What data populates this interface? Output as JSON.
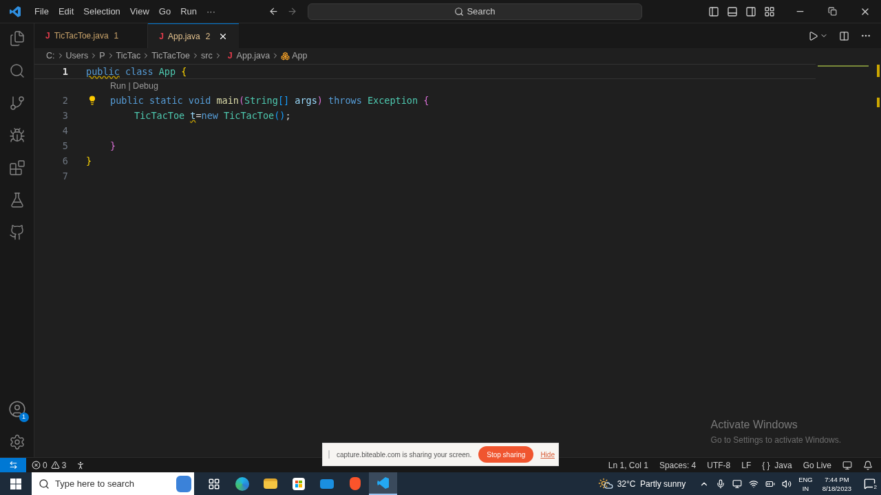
{
  "menu": [
    "File",
    "Edit",
    "Selection",
    "View",
    "Go",
    "Run",
    "···"
  ],
  "search": {
    "placeholder": "Search"
  },
  "tabs": [
    {
      "icon": "J",
      "label": "TicTacToe.java",
      "count": "1",
      "selected": false
    },
    {
      "icon": "J",
      "label": "App.java",
      "count": "2",
      "selected": true
    }
  ],
  "breadcrumb": [
    {
      "text": "C:",
      "kind": "folder"
    },
    {
      "text": "Users",
      "kind": "folder"
    },
    {
      "text": "P",
      "kind": "folder"
    },
    {
      "text": "TicTac",
      "kind": "folder"
    },
    {
      "text": "TicTacToe",
      "kind": "folder"
    },
    {
      "text": "src",
      "kind": "folder"
    },
    {
      "text": "App.java",
      "kind": "java",
      "icon": "J"
    },
    {
      "text": "App",
      "kind": "class"
    }
  ],
  "code": [
    {
      "number": "1",
      "current": true,
      "tokens": [
        {
          "text": "public",
          "kind": "keyword",
          "warning": true
        },
        {
          "text": " class",
          "kind": "keyword"
        },
        {
          "text": " App",
          "kind": "type"
        },
        {
          "text": " {",
          "kind": "bracket1"
        }
      ],
      "children": [
        {
          "number": "2",
          "codelens": "Run | Debug",
          "lightbulb": true,
          "tokens": [
            {
              "text": "public",
              "kind": "keyword"
            },
            {
              "text": " static",
              "kind": "keyword"
            },
            {
              "text": " void",
              "kind": "keyword"
            },
            {
              "text": " main",
              "kind": "function"
            },
            {
              "text": "(",
              "kind": "bracket2"
            },
            {
              "text": "String",
              "kind": "type"
            },
            {
              "text": "[]",
              "kind": "bracket3"
            },
            {
              "text": " args",
              "kind": "variable"
            },
            {
              "text": ")",
              "kind": "bracket2"
            },
            {
              "text": " throws",
              "kind": "keyword"
            },
            {
              "text": " Exception",
              "kind": "type"
            },
            {
              "text": " {",
              "kind": "bracket2"
            }
          ],
          "children": [
            {
              "number": "3",
              "tokens": [
                {
                  "text": "TicTacToe ",
                  "kind": "type"
                },
                {
                  "text": "t",
                  "kind": "variable",
                  "warning": true
                },
                {
                  "text": "=",
                  "kind": "plain"
                },
                {
                  "text": "new",
                  "kind": "keyword"
                },
                {
                  "text": " TicTacToe",
                  "kind": "type"
                },
                {
                  "text": "()",
                  "kind": "bracket3"
                },
                {
                  "text": ";",
                  "kind": "plain"
                }
              ]
            },
            {
              "number": "4"
            }
          ]
        },
        {
          "number": "5",
          "tokens": [
            {
              "text": "}",
              "kind": "bracket2"
            }
          ]
        }
      ]
    },
    {
      "number": "6",
      "tokens": [
        {
          "text": "}",
          "kind": "bracket1"
        }
      ]
    },
    {
      "number": "7"
    }
  ],
  "activity_bar": {
    "accounts_badge": "1"
  },
  "status_bar": {
    "errors": "0",
    "warnings": "3",
    "right": [
      "Ln 1, Col 1",
      "Spaces: 4",
      "UTF-8",
      "LF",
      "{ }  Java",
      "Go Live"
    ]
  },
  "activation": {
    "title": "Activate Windows",
    "text": "Go to Settings to activate Windows."
  },
  "sharing_bar": {
    "text": "capture.biteable.com is sharing your screen.",
    "stop": "Stop sharing",
    "hide": "Hide"
  },
  "taskbar": {
    "search_placeholder": "Type here to search",
    "apps": [
      {
        "kind": "task-view",
        "selected": false
      },
      {
        "kind": "edge",
        "selected": false
      },
      {
        "kind": "explorer",
        "selected": false
      },
      {
        "kind": "store",
        "selected": false
      },
      {
        "kind": "mail",
        "selected": false
      },
      {
        "kind": "brave",
        "selected": false
      },
      {
        "kind": "vscode",
        "selected": true
      }
    ],
    "weather": "32°C  Partly sunny",
    "language": "ENG",
    "region": "IN",
    "time": "7:44 PM",
    "date": "8/18/2023",
    "notifications": "2"
  }
}
